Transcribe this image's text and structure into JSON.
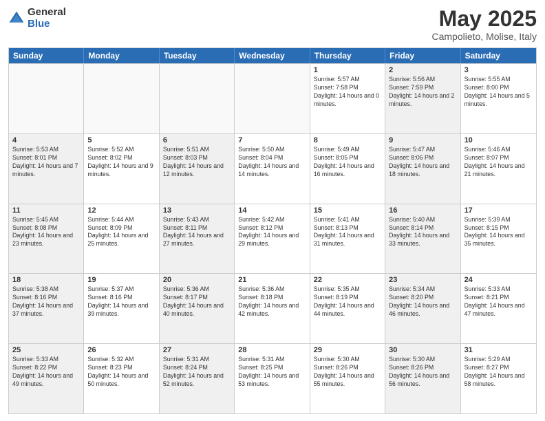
{
  "logo": {
    "general": "General",
    "blue": "Blue"
  },
  "title": "May 2025",
  "location": "Campolieto, Molise, Italy",
  "days": [
    "Sunday",
    "Monday",
    "Tuesday",
    "Wednesday",
    "Thursday",
    "Friday",
    "Saturday"
  ],
  "rows": [
    [
      {
        "day": "",
        "info": "",
        "empty": true
      },
      {
        "day": "",
        "info": "",
        "empty": true
      },
      {
        "day": "",
        "info": "",
        "empty": true
      },
      {
        "day": "",
        "info": "",
        "empty": true
      },
      {
        "day": "1",
        "info": "Sunrise: 5:57 AM\nSunset: 7:58 PM\nDaylight: 14 hours and 0 minutes.",
        "shaded": false
      },
      {
        "day": "2",
        "info": "Sunrise: 5:56 AM\nSunset: 7:59 PM\nDaylight: 14 hours and 2 minutes.",
        "shaded": true
      },
      {
        "day": "3",
        "info": "Sunrise: 5:55 AM\nSunset: 8:00 PM\nDaylight: 14 hours and 5 minutes.",
        "shaded": false
      }
    ],
    [
      {
        "day": "4",
        "info": "Sunrise: 5:53 AM\nSunset: 8:01 PM\nDaylight: 14 hours and 7 minutes.",
        "shaded": true
      },
      {
        "day": "5",
        "info": "Sunrise: 5:52 AM\nSunset: 8:02 PM\nDaylight: 14 hours and 9 minutes.",
        "shaded": false
      },
      {
        "day": "6",
        "info": "Sunrise: 5:51 AM\nSunset: 8:03 PM\nDaylight: 14 hours and 12 minutes.",
        "shaded": true
      },
      {
        "day": "7",
        "info": "Sunrise: 5:50 AM\nSunset: 8:04 PM\nDaylight: 14 hours and 14 minutes.",
        "shaded": false
      },
      {
        "day": "8",
        "info": "Sunrise: 5:49 AM\nSunset: 8:05 PM\nDaylight: 14 hours and 16 minutes.",
        "shaded": false
      },
      {
        "day": "9",
        "info": "Sunrise: 5:47 AM\nSunset: 8:06 PM\nDaylight: 14 hours and 18 minutes.",
        "shaded": true
      },
      {
        "day": "10",
        "info": "Sunrise: 5:46 AM\nSunset: 8:07 PM\nDaylight: 14 hours and 21 minutes.",
        "shaded": false
      }
    ],
    [
      {
        "day": "11",
        "info": "Sunrise: 5:45 AM\nSunset: 8:08 PM\nDaylight: 14 hours and 23 minutes.",
        "shaded": true
      },
      {
        "day": "12",
        "info": "Sunrise: 5:44 AM\nSunset: 8:09 PM\nDaylight: 14 hours and 25 minutes.",
        "shaded": false
      },
      {
        "day": "13",
        "info": "Sunrise: 5:43 AM\nSunset: 8:11 PM\nDaylight: 14 hours and 27 minutes.",
        "shaded": true
      },
      {
        "day": "14",
        "info": "Sunrise: 5:42 AM\nSunset: 8:12 PM\nDaylight: 14 hours and 29 minutes.",
        "shaded": false
      },
      {
        "day": "15",
        "info": "Sunrise: 5:41 AM\nSunset: 8:13 PM\nDaylight: 14 hours and 31 minutes.",
        "shaded": false
      },
      {
        "day": "16",
        "info": "Sunrise: 5:40 AM\nSunset: 8:14 PM\nDaylight: 14 hours and 33 minutes.",
        "shaded": true
      },
      {
        "day": "17",
        "info": "Sunrise: 5:39 AM\nSunset: 8:15 PM\nDaylight: 14 hours and 35 minutes.",
        "shaded": false
      }
    ],
    [
      {
        "day": "18",
        "info": "Sunrise: 5:38 AM\nSunset: 8:16 PM\nDaylight: 14 hours and 37 minutes.",
        "shaded": true
      },
      {
        "day": "19",
        "info": "Sunrise: 5:37 AM\nSunset: 8:16 PM\nDaylight: 14 hours and 39 minutes.",
        "shaded": false
      },
      {
        "day": "20",
        "info": "Sunrise: 5:36 AM\nSunset: 8:17 PM\nDaylight: 14 hours and 40 minutes.",
        "shaded": true
      },
      {
        "day": "21",
        "info": "Sunrise: 5:36 AM\nSunset: 8:18 PM\nDaylight: 14 hours and 42 minutes.",
        "shaded": false
      },
      {
        "day": "22",
        "info": "Sunrise: 5:35 AM\nSunset: 8:19 PM\nDaylight: 14 hours and 44 minutes.",
        "shaded": false
      },
      {
        "day": "23",
        "info": "Sunrise: 5:34 AM\nSunset: 8:20 PM\nDaylight: 14 hours and 46 minutes.",
        "shaded": true
      },
      {
        "day": "24",
        "info": "Sunrise: 5:33 AM\nSunset: 8:21 PM\nDaylight: 14 hours and 47 minutes.",
        "shaded": false
      }
    ],
    [
      {
        "day": "25",
        "info": "Sunrise: 5:33 AM\nSunset: 8:22 PM\nDaylight: 14 hours and 49 minutes.",
        "shaded": true
      },
      {
        "day": "26",
        "info": "Sunrise: 5:32 AM\nSunset: 8:23 PM\nDaylight: 14 hours and 50 minutes.",
        "shaded": false
      },
      {
        "day": "27",
        "info": "Sunrise: 5:31 AM\nSunset: 8:24 PM\nDaylight: 14 hours and 52 minutes.",
        "shaded": true
      },
      {
        "day": "28",
        "info": "Sunrise: 5:31 AM\nSunset: 8:25 PM\nDaylight: 14 hours and 53 minutes.",
        "shaded": false
      },
      {
        "day": "29",
        "info": "Sunrise: 5:30 AM\nSunset: 8:26 PM\nDaylight: 14 hours and 55 minutes.",
        "shaded": false
      },
      {
        "day": "30",
        "info": "Sunrise: 5:30 AM\nSunset: 8:26 PM\nDaylight: 14 hours and 56 minutes.",
        "shaded": true
      },
      {
        "day": "31",
        "info": "Sunrise: 5:29 AM\nSunset: 8:27 PM\nDaylight: 14 hours and 58 minutes.",
        "shaded": false
      }
    ]
  ]
}
